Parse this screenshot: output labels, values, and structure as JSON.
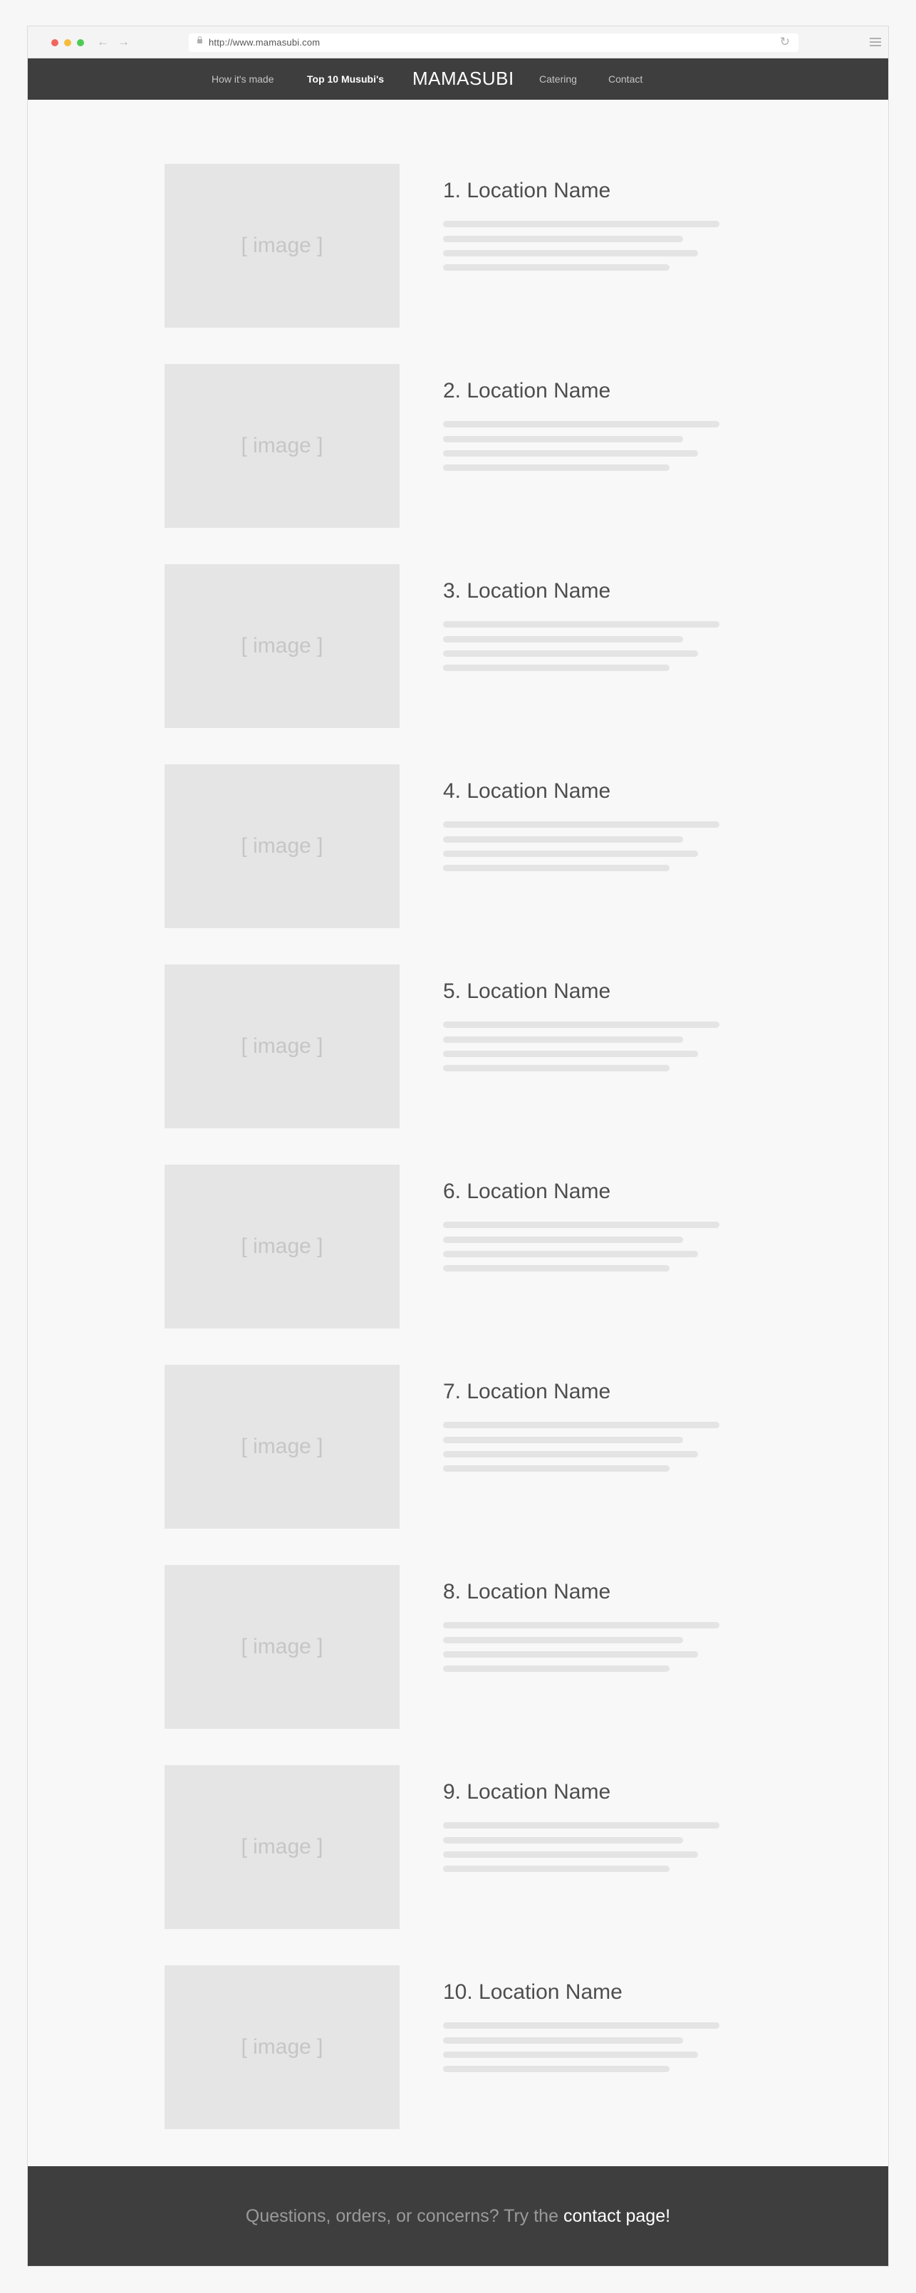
{
  "browser": {
    "url": "http://www.mamasubi.com",
    "back_icon": "←",
    "forward_icon": "→",
    "reload_icon": "↻"
  },
  "nav": {
    "how_its_made": "How it's made",
    "top10": "Top 10 Musubi's",
    "brand": "MAMASUBI",
    "catering": "Catering",
    "contact": "Contact"
  },
  "locations": [
    {
      "title": "1. Location Name",
      "image_label": "[ image ]"
    },
    {
      "title": "2. Location Name",
      "image_label": "[ image ]"
    },
    {
      "title": "3. Location Name",
      "image_label": "[ image ]"
    },
    {
      "title": "4. Location Name",
      "image_label": "[ image ]"
    },
    {
      "title": "5. Location Name",
      "image_label": "[ image ]"
    },
    {
      "title": "6. Location Name",
      "image_label": "[ image ]"
    },
    {
      "title": "7. Location Name",
      "image_label": "[ image ]"
    },
    {
      "title": "8. Location Name",
      "image_label": "[ image ]"
    },
    {
      "title": "9. Location Name",
      "image_label": "[ image ]"
    },
    {
      "title": "10. Location Name",
      "image_label": "[ image ]"
    }
  ],
  "footer": {
    "text": "Questions, orders, or concerns? Try the ",
    "link": "contact page!"
  },
  "colors": {
    "nav_bg": "#3e3e3e",
    "placeholder": "#e5e5e5",
    "dot_red": "#f2655f",
    "dot_yellow": "#f6bd3c",
    "dot_green": "#4fcb55"
  }
}
